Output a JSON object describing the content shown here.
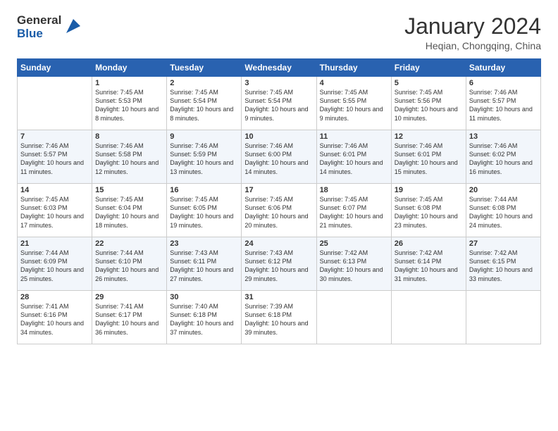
{
  "logo": {
    "line1": "General",
    "line2": "Blue"
  },
  "title": "January 2024",
  "subtitle": "Heqian, Chongqing, China",
  "header_days": [
    "Sunday",
    "Monday",
    "Tuesday",
    "Wednesday",
    "Thursday",
    "Friday",
    "Saturday"
  ],
  "weeks": [
    [
      {
        "day": "",
        "sunrise": "",
        "sunset": "",
        "daylight": ""
      },
      {
        "day": "1",
        "sunrise": "Sunrise: 7:45 AM",
        "sunset": "Sunset: 5:53 PM",
        "daylight": "Daylight: 10 hours and 8 minutes."
      },
      {
        "day": "2",
        "sunrise": "Sunrise: 7:45 AM",
        "sunset": "Sunset: 5:54 PM",
        "daylight": "Daylight: 10 hours and 8 minutes."
      },
      {
        "day": "3",
        "sunrise": "Sunrise: 7:45 AM",
        "sunset": "Sunset: 5:54 PM",
        "daylight": "Daylight: 10 hours and 9 minutes."
      },
      {
        "day": "4",
        "sunrise": "Sunrise: 7:45 AM",
        "sunset": "Sunset: 5:55 PM",
        "daylight": "Daylight: 10 hours and 9 minutes."
      },
      {
        "day": "5",
        "sunrise": "Sunrise: 7:45 AM",
        "sunset": "Sunset: 5:56 PM",
        "daylight": "Daylight: 10 hours and 10 minutes."
      },
      {
        "day": "6",
        "sunrise": "Sunrise: 7:46 AM",
        "sunset": "Sunset: 5:57 PM",
        "daylight": "Daylight: 10 hours and 11 minutes."
      }
    ],
    [
      {
        "day": "7",
        "sunrise": "Sunrise: 7:46 AM",
        "sunset": "Sunset: 5:57 PM",
        "daylight": "Daylight: 10 hours and 11 minutes."
      },
      {
        "day": "8",
        "sunrise": "Sunrise: 7:46 AM",
        "sunset": "Sunset: 5:58 PM",
        "daylight": "Daylight: 10 hours and 12 minutes."
      },
      {
        "day": "9",
        "sunrise": "Sunrise: 7:46 AM",
        "sunset": "Sunset: 5:59 PM",
        "daylight": "Daylight: 10 hours and 13 minutes."
      },
      {
        "day": "10",
        "sunrise": "Sunrise: 7:46 AM",
        "sunset": "Sunset: 6:00 PM",
        "daylight": "Daylight: 10 hours and 14 minutes."
      },
      {
        "day": "11",
        "sunrise": "Sunrise: 7:46 AM",
        "sunset": "Sunset: 6:01 PM",
        "daylight": "Daylight: 10 hours and 14 minutes."
      },
      {
        "day": "12",
        "sunrise": "Sunrise: 7:46 AM",
        "sunset": "Sunset: 6:01 PM",
        "daylight": "Daylight: 10 hours and 15 minutes."
      },
      {
        "day": "13",
        "sunrise": "Sunrise: 7:46 AM",
        "sunset": "Sunset: 6:02 PM",
        "daylight": "Daylight: 10 hours and 16 minutes."
      }
    ],
    [
      {
        "day": "14",
        "sunrise": "Sunrise: 7:45 AM",
        "sunset": "Sunset: 6:03 PM",
        "daylight": "Daylight: 10 hours and 17 minutes."
      },
      {
        "day": "15",
        "sunrise": "Sunrise: 7:45 AM",
        "sunset": "Sunset: 6:04 PM",
        "daylight": "Daylight: 10 hours and 18 minutes."
      },
      {
        "day": "16",
        "sunrise": "Sunrise: 7:45 AM",
        "sunset": "Sunset: 6:05 PM",
        "daylight": "Daylight: 10 hours and 19 minutes."
      },
      {
        "day": "17",
        "sunrise": "Sunrise: 7:45 AM",
        "sunset": "Sunset: 6:06 PM",
        "daylight": "Daylight: 10 hours and 20 minutes."
      },
      {
        "day": "18",
        "sunrise": "Sunrise: 7:45 AM",
        "sunset": "Sunset: 6:07 PM",
        "daylight": "Daylight: 10 hours and 21 minutes."
      },
      {
        "day": "19",
        "sunrise": "Sunrise: 7:45 AM",
        "sunset": "Sunset: 6:08 PM",
        "daylight": "Daylight: 10 hours and 23 minutes."
      },
      {
        "day": "20",
        "sunrise": "Sunrise: 7:44 AM",
        "sunset": "Sunset: 6:08 PM",
        "daylight": "Daylight: 10 hours and 24 minutes."
      }
    ],
    [
      {
        "day": "21",
        "sunrise": "Sunrise: 7:44 AM",
        "sunset": "Sunset: 6:09 PM",
        "daylight": "Daylight: 10 hours and 25 minutes."
      },
      {
        "day": "22",
        "sunrise": "Sunrise: 7:44 AM",
        "sunset": "Sunset: 6:10 PM",
        "daylight": "Daylight: 10 hours and 26 minutes."
      },
      {
        "day": "23",
        "sunrise": "Sunrise: 7:43 AM",
        "sunset": "Sunset: 6:11 PM",
        "daylight": "Daylight: 10 hours and 27 minutes."
      },
      {
        "day": "24",
        "sunrise": "Sunrise: 7:43 AM",
        "sunset": "Sunset: 6:12 PM",
        "daylight": "Daylight: 10 hours and 29 minutes."
      },
      {
        "day": "25",
        "sunrise": "Sunrise: 7:42 AM",
        "sunset": "Sunset: 6:13 PM",
        "daylight": "Daylight: 10 hours and 30 minutes."
      },
      {
        "day": "26",
        "sunrise": "Sunrise: 7:42 AM",
        "sunset": "Sunset: 6:14 PM",
        "daylight": "Daylight: 10 hours and 31 minutes."
      },
      {
        "day": "27",
        "sunrise": "Sunrise: 7:42 AM",
        "sunset": "Sunset: 6:15 PM",
        "daylight": "Daylight: 10 hours and 33 minutes."
      }
    ],
    [
      {
        "day": "28",
        "sunrise": "Sunrise: 7:41 AM",
        "sunset": "Sunset: 6:16 PM",
        "daylight": "Daylight: 10 hours and 34 minutes."
      },
      {
        "day": "29",
        "sunrise": "Sunrise: 7:41 AM",
        "sunset": "Sunset: 6:17 PM",
        "daylight": "Daylight: 10 hours and 36 minutes."
      },
      {
        "day": "30",
        "sunrise": "Sunrise: 7:40 AM",
        "sunset": "Sunset: 6:18 PM",
        "daylight": "Daylight: 10 hours and 37 minutes."
      },
      {
        "day": "31",
        "sunrise": "Sunrise: 7:39 AM",
        "sunset": "Sunset: 6:18 PM",
        "daylight": "Daylight: 10 hours and 39 minutes."
      },
      {
        "day": "",
        "sunrise": "",
        "sunset": "",
        "daylight": ""
      },
      {
        "day": "",
        "sunrise": "",
        "sunset": "",
        "daylight": ""
      },
      {
        "day": "",
        "sunrise": "",
        "sunset": "",
        "daylight": ""
      }
    ]
  ]
}
